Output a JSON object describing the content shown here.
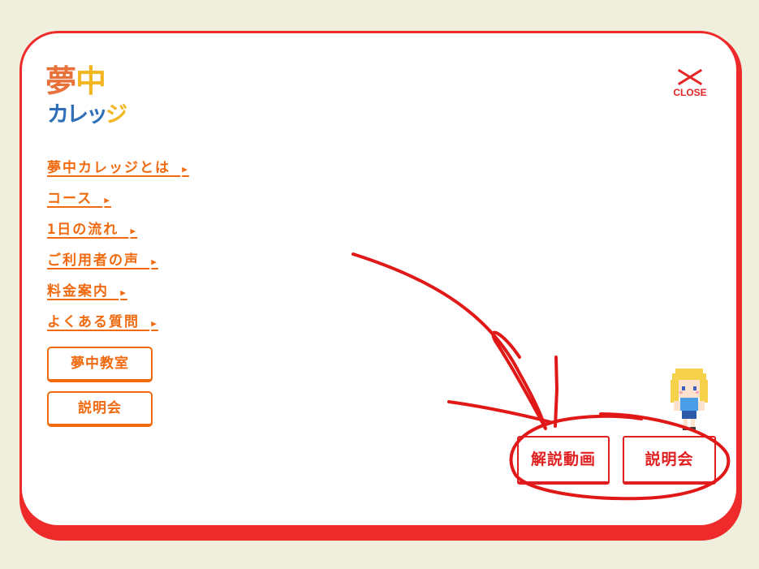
{
  "logo": {
    "top": [
      "夢",
      "中"
    ],
    "bottom": [
      "カレッ",
      "ジ"
    ]
  },
  "close": {
    "label": "CLOSE"
  },
  "nav": {
    "items": [
      {
        "label": "夢中カレッジとは",
        "arrow": "▶"
      },
      {
        "label": "コース",
        "arrow": "▶"
      },
      {
        "label": "1日の流れ",
        "arrow": "▶"
      },
      {
        "label": "ご利用者の声",
        "arrow": "▶"
      },
      {
        "label": "料金案内",
        "arrow": "▶"
      },
      {
        "label": "よくある質問",
        "arrow": "▶"
      }
    ]
  },
  "side_buttons": {
    "classroom": "夢中教室",
    "briefing": "説明会"
  },
  "bottom_buttons": {
    "video": "解説動画",
    "briefing": "説明会"
  },
  "colors": {
    "background": "#f0eedd",
    "modal_border": "#ee2a2a",
    "nav_text": "#f06a10",
    "bottom_button": "#e02020",
    "annotation": "#e01818"
  }
}
